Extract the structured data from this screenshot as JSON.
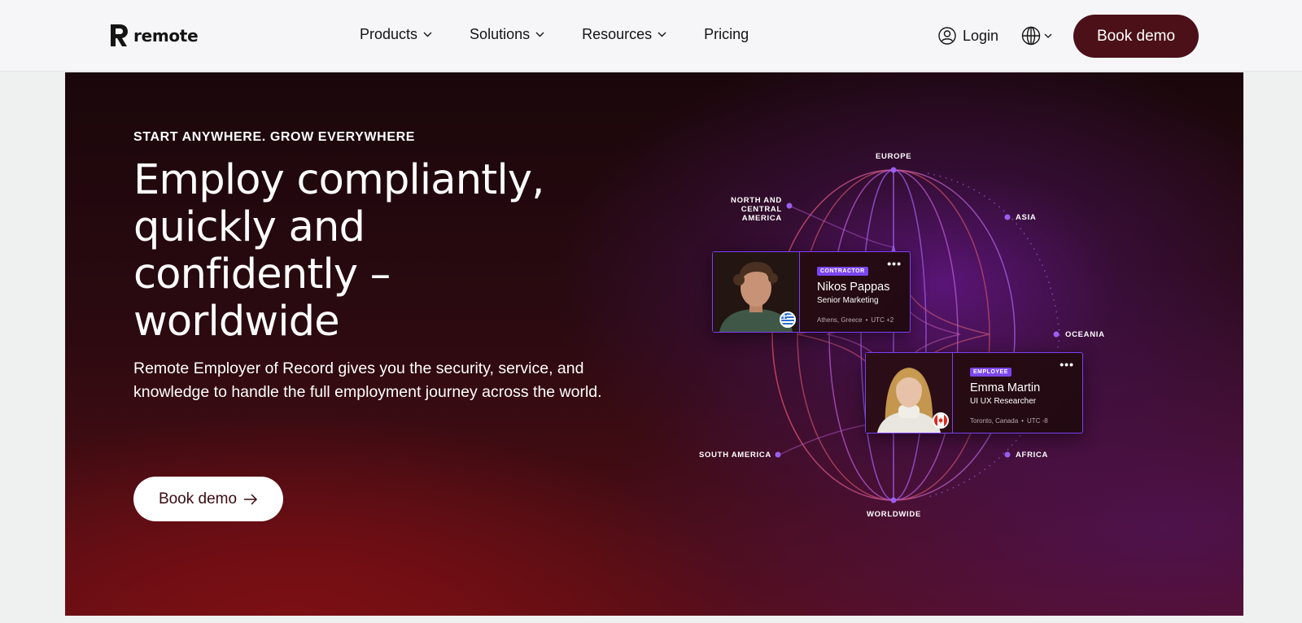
{
  "brand": {
    "name": "remote"
  },
  "nav": {
    "items": [
      {
        "label": "Products",
        "has_dropdown": true
      },
      {
        "label": "Solutions",
        "has_dropdown": true
      },
      {
        "label": "Resources",
        "has_dropdown": true
      },
      {
        "label": "Pricing",
        "has_dropdown": false
      }
    ],
    "login_label": "Login",
    "language_icon": "globe-icon",
    "cta_label": "Book demo"
  },
  "hero": {
    "eyebrow": "START ANYWHERE. GROW EVERYWHERE",
    "headline_lines": [
      "Employ compliantly,",
      "quickly and",
      "confidently –",
      "worldwide"
    ],
    "subcopy": "Remote Employer of Record gives you the security, service, and knowledge to handle the full employment journey across the world.",
    "cta_label": "Book demo",
    "cta_icon": "arrow-right-icon"
  },
  "globe": {
    "regions": {
      "europe": "EUROPE",
      "north_america": [
        "NORTH AND CENTRAL",
        "AMERICA"
      ],
      "asia": "ASIA",
      "oceania": "OCEANIA",
      "south_america": "SOUTH AMERICA",
      "africa": "AFRICA",
      "worldwide": "WORLDWIDE"
    }
  },
  "cards": [
    {
      "badge": "CONTRACTOR",
      "name": "Nikos Pappas",
      "role": "Senior Marketing",
      "location": "Athens, Greece",
      "timezone": "UTC +2",
      "flag": "greece-flag-icon",
      "menu_icon": "more-dots-icon"
    },
    {
      "badge": "EMPLOYEE",
      "name": "Emma Martin",
      "role": "UI UX Researcher",
      "location": "Toronto, Canada",
      "timezone": "UTC -8",
      "flag": "canada-flag-icon",
      "menu_icon": "more-dots-icon"
    }
  ],
  "colors": {
    "brand_dark": "#4b1018",
    "hero_red": "#7c0f14",
    "accent_purple": "#7b46f0",
    "header_bg": "#f6f6f8"
  }
}
